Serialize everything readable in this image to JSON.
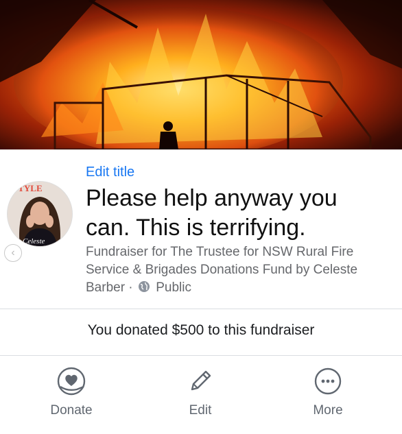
{
  "header": {
    "edit_title_label": "Edit title"
  },
  "fundraiser": {
    "title": "Please help anyway you can. This is terrifying.",
    "subtitle_prefix": "Fundraiser for The Trustee for NSW Rural Fire Service & Brigades Donations Fund by Celeste Barber ·",
    "privacy": "Public"
  },
  "donation": {
    "message": "You donated $500 to this fundraiser"
  },
  "actions": [
    {
      "label": "Donate",
      "icon": "donate-heart-hand-icon"
    },
    {
      "label": "Edit",
      "icon": "pencil-icon"
    },
    {
      "label": "More",
      "icon": "more-dots-icon"
    }
  ],
  "colors": {
    "link_blue": "#1877f2",
    "secondary_text": "#65676b",
    "divider": "#dadde1"
  }
}
